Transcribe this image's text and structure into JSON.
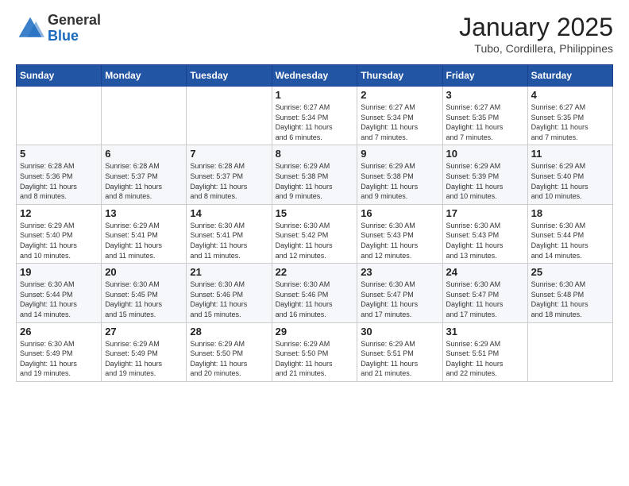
{
  "header": {
    "logo_general": "General",
    "logo_blue": "Blue",
    "month": "January 2025",
    "location": "Tubo, Cordillera, Philippines"
  },
  "days_of_week": [
    "Sunday",
    "Monday",
    "Tuesday",
    "Wednesday",
    "Thursday",
    "Friday",
    "Saturday"
  ],
  "weeks": [
    [
      {
        "day": "",
        "info": ""
      },
      {
        "day": "",
        "info": ""
      },
      {
        "day": "",
        "info": ""
      },
      {
        "day": "1",
        "info": "Sunrise: 6:27 AM\nSunset: 5:34 PM\nDaylight: 11 hours\nand 6 minutes."
      },
      {
        "day": "2",
        "info": "Sunrise: 6:27 AM\nSunset: 5:34 PM\nDaylight: 11 hours\nand 7 minutes."
      },
      {
        "day": "3",
        "info": "Sunrise: 6:27 AM\nSunset: 5:35 PM\nDaylight: 11 hours\nand 7 minutes."
      },
      {
        "day": "4",
        "info": "Sunrise: 6:27 AM\nSunset: 5:35 PM\nDaylight: 11 hours\nand 7 minutes."
      }
    ],
    [
      {
        "day": "5",
        "info": "Sunrise: 6:28 AM\nSunset: 5:36 PM\nDaylight: 11 hours\nand 8 minutes."
      },
      {
        "day": "6",
        "info": "Sunrise: 6:28 AM\nSunset: 5:37 PM\nDaylight: 11 hours\nand 8 minutes."
      },
      {
        "day": "7",
        "info": "Sunrise: 6:28 AM\nSunset: 5:37 PM\nDaylight: 11 hours\nand 8 minutes."
      },
      {
        "day": "8",
        "info": "Sunrise: 6:29 AM\nSunset: 5:38 PM\nDaylight: 11 hours\nand 9 minutes."
      },
      {
        "day": "9",
        "info": "Sunrise: 6:29 AM\nSunset: 5:38 PM\nDaylight: 11 hours\nand 9 minutes."
      },
      {
        "day": "10",
        "info": "Sunrise: 6:29 AM\nSunset: 5:39 PM\nDaylight: 11 hours\nand 10 minutes."
      },
      {
        "day": "11",
        "info": "Sunrise: 6:29 AM\nSunset: 5:40 PM\nDaylight: 11 hours\nand 10 minutes."
      }
    ],
    [
      {
        "day": "12",
        "info": "Sunrise: 6:29 AM\nSunset: 5:40 PM\nDaylight: 11 hours\nand 10 minutes."
      },
      {
        "day": "13",
        "info": "Sunrise: 6:29 AM\nSunset: 5:41 PM\nDaylight: 11 hours\nand 11 minutes."
      },
      {
        "day": "14",
        "info": "Sunrise: 6:30 AM\nSunset: 5:41 PM\nDaylight: 11 hours\nand 11 minutes."
      },
      {
        "day": "15",
        "info": "Sunrise: 6:30 AM\nSunset: 5:42 PM\nDaylight: 11 hours\nand 12 minutes."
      },
      {
        "day": "16",
        "info": "Sunrise: 6:30 AM\nSunset: 5:43 PM\nDaylight: 11 hours\nand 12 minutes."
      },
      {
        "day": "17",
        "info": "Sunrise: 6:30 AM\nSunset: 5:43 PM\nDaylight: 11 hours\nand 13 minutes."
      },
      {
        "day": "18",
        "info": "Sunrise: 6:30 AM\nSunset: 5:44 PM\nDaylight: 11 hours\nand 14 minutes."
      }
    ],
    [
      {
        "day": "19",
        "info": "Sunrise: 6:30 AM\nSunset: 5:44 PM\nDaylight: 11 hours\nand 14 minutes."
      },
      {
        "day": "20",
        "info": "Sunrise: 6:30 AM\nSunset: 5:45 PM\nDaylight: 11 hours\nand 15 minutes."
      },
      {
        "day": "21",
        "info": "Sunrise: 6:30 AM\nSunset: 5:46 PM\nDaylight: 11 hours\nand 15 minutes."
      },
      {
        "day": "22",
        "info": "Sunrise: 6:30 AM\nSunset: 5:46 PM\nDaylight: 11 hours\nand 16 minutes."
      },
      {
        "day": "23",
        "info": "Sunrise: 6:30 AM\nSunset: 5:47 PM\nDaylight: 11 hours\nand 17 minutes."
      },
      {
        "day": "24",
        "info": "Sunrise: 6:30 AM\nSunset: 5:47 PM\nDaylight: 11 hours\nand 17 minutes."
      },
      {
        "day": "25",
        "info": "Sunrise: 6:30 AM\nSunset: 5:48 PM\nDaylight: 11 hours\nand 18 minutes."
      }
    ],
    [
      {
        "day": "26",
        "info": "Sunrise: 6:30 AM\nSunset: 5:49 PM\nDaylight: 11 hours\nand 19 minutes."
      },
      {
        "day": "27",
        "info": "Sunrise: 6:29 AM\nSunset: 5:49 PM\nDaylight: 11 hours\nand 19 minutes."
      },
      {
        "day": "28",
        "info": "Sunrise: 6:29 AM\nSunset: 5:50 PM\nDaylight: 11 hours\nand 20 minutes."
      },
      {
        "day": "29",
        "info": "Sunrise: 6:29 AM\nSunset: 5:50 PM\nDaylight: 11 hours\nand 21 minutes."
      },
      {
        "day": "30",
        "info": "Sunrise: 6:29 AM\nSunset: 5:51 PM\nDaylight: 11 hours\nand 21 minutes."
      },
      {
        "day": "31",
        "info": "Sunrise: 6:29 AM\nSunset: 5:51 PM\nDaylight: 11 hours\nand 22 minutes."
      },
      {
        "day": "",
        "info": ""
      }
    ]
  ]
}
